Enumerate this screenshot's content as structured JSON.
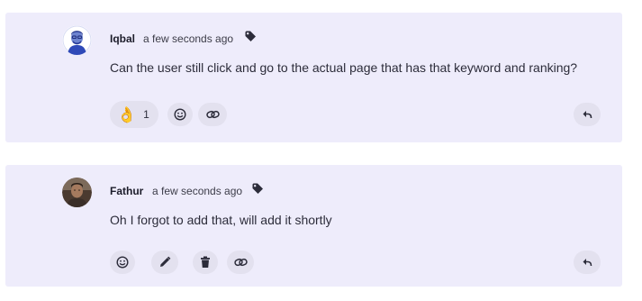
{
  "comments": [
    {
      "author": "Iqbal",
      "timestamp": "a few seconds ago",
      "text": "Can the user still click and go to the actual page that has that keyword and ranking?",
      "reactions": [
        {
          "emoji": "👌",
          "count": "1"
        }
      ],
      "actions": [
        "add-reaction",
        "copy-link",
        "reply"
      ]
    },
    {
      "author": "Fathur",
      "timestamp": "a few seconds ago",
      "text": "Oh I forgot to add that, will add it shortly",
      "reactions": [],
      "actions": [
        "add-reaction",
        "edit",
        "delete",
        "copy-link",
        "reply"
      ]
    }
  ],
  "colors": {
    "card_background": "#eeecfb",
    "button_background": "#e3e1ef",
    "icon": "#2c2c3a"
  },
  "icons": {
    "tag": "tag-icon",
    "add_reaction": "smiley-icon",
    "edit": "pencil-icon",
    "delete": "trash-icon",
    "copy_link": "link-icon",
    "reply": "reply-arrow-icon"
  }
}
